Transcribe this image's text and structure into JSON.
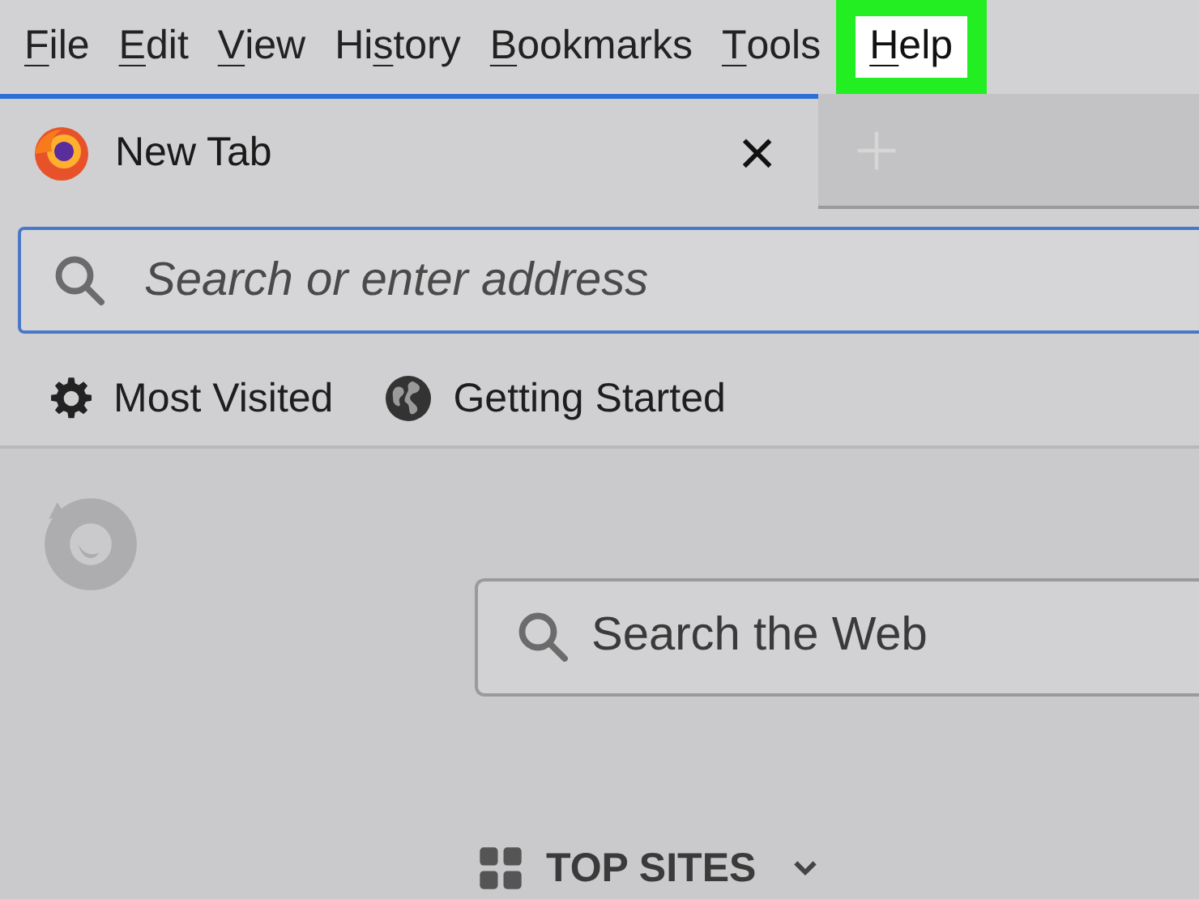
{
  "menu_bar": [
    {
      "parts": [
        {
          "text": "F",
          "underlined": true
        },
        {
          "text": "ile",
          "underlined": false
        }
      ],
      "selected": false
    },
    {
      "parts": [
        {
          "text": "E",
          "underlined": true
        },
        {
          "text": "dit",
          "underlined": false
        }
      ],
      "selected": false
    },
    {
      "parts": [
        {
          "text": "V",
          "underlined": true
        },
        {
          "text": "iew",
          "underlined": false
        }
      ],
      "selected": false
    },
    {
      "parts": [
        {
          "text": "Hi",
          "underlined": false
        },
        {
          "text": "s",
          "underlined": true
        },
        {
          "text": "tory",
          "underlined": false
        }
      ],
      "selected": false
    },
    {
      "parts": [
        {
          "text": "B",
          "underlined": true
        },
        {
          "text": "ookmarks",
          "underlined": false
        }
      ],
      "selected": false
    },
    {
      "parts": [
        {
          "text": "T",
          "underlined": true
        },
        {
          "text": "ools",
          "underlined": false
        }
      ],
      "selected": false
    },
    {
      "parts": [
        {
          "text": "H",
          "underlined": true
        },
        {
          "text": "elp",
          "underlined": false
        }
      ],
      "selected": true
    }
  ],
  "tabs": [
    {
      "label": "New Tab",
      "close": "×",
      "selected": true
    }
  ],
  "address_bar": {
    "placeholder": "Search or enter address"
  },
  "bookmarks": [
    {
      "kind": "gear",
      "label": "Most Visited"
    },
    {
      "kind": "globe",
      "label": "Getting Started"
    }
  ],
  "new_tab_page": {
    "search": {
      "placeholder": "Search the Web"
    },
    "top_sites": {
      "label": "TOP SITES",
      "expanded": true
    }
  }
}
